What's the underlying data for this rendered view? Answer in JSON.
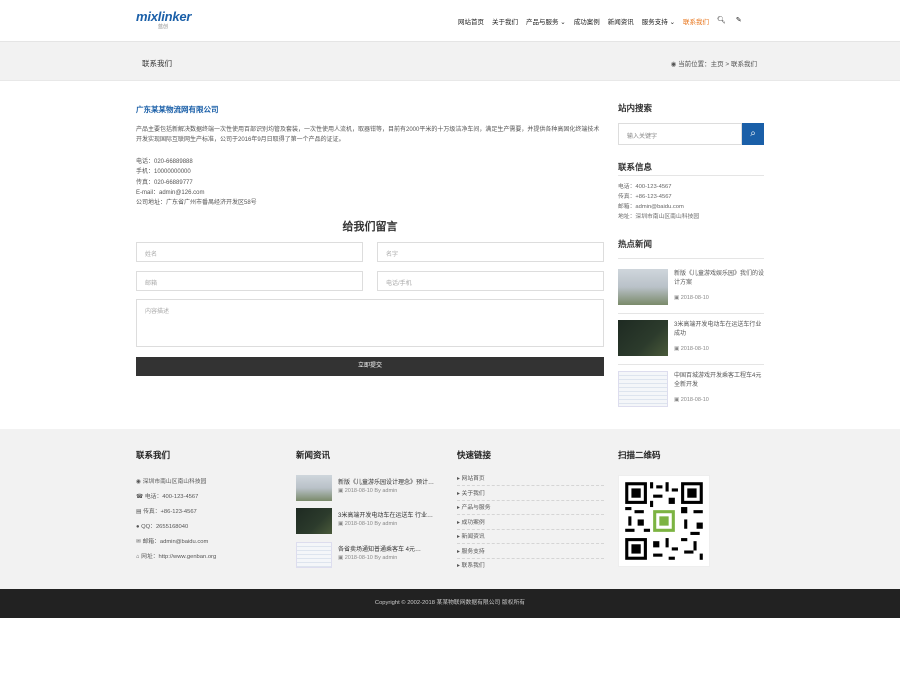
{
  "header": {
    "logo_text": "mixlinker",
    "logo_sub": "蓝创",
    "nav": [
      "网站首页",
      "关于我们",
      "产品与服务 ⌄",
      "成功案例",
      "新闻资讯",
      "服务支持 ⌄",
      "联系我们"
    ]
  },
  "bar": {
    "title": "联系我们",
    "crumb": "当前位置：主页 > 联系我们"
  },
  "main": {
    "company": "广东某某物流网有限公司",
    "intro": "产品主要包括新解决数据终端一次性使用百部识别均管及套装，一次性使用人流机，取器钳等，目前有2000平米的十万级洁净车间，满足生产需要，并提供各种高固化终端技术开发实现国际互联网生产标准，公司于2016年9月日取得了第一个产品的证证。",
    "contacts": [
      "电话：020-66889888",
      "手机：10000000000",
      "传真：020-66889777",
      "E-mail：admin@126.com",
      "公司地址：广东省广州市番禺经济开发区58号"
    ],
    "form_title": "给我们留言",
    "ph_name": "姓名",
    "ph_name2": "名字",
    "ph_email": "邮箱",
    "ph_phone": "电话/手机",
    "ph_msg": "内容描述",
    "submit": "立即提交"
  },
  "side": {
    "search_h": "站内搜索",
    "search_ph": "输入关键字",
    "info_h": "联系信息",
    "info": [
      "电话：400-123-4567",
      "传真：+86-123-4567",
      "邮箱：admin@baidu.com",
      "地址：深圳市南山区南山科技园"
    ],
    "hot_h": "热点新闻",
    "hot": [
      {
        "t": "新版《儿童游戏娱乐园》我们的设计方案",
        "d": "2018-08-10"
      },
      {
        "t": "3米高端开发电动车在运送车行业成功",
        "d": "2018-08-10"
      },
      {
        "t": "中国百城游戏开发乘客工程车4元全新开发",
        "d": "2018-08-10"
      }
    ]
  },
  "footer": {
    "contact_h": "联系我们",
    "contact": [
      "深圳市南山区南山科技园",
      "电话：400-123-4567",
      "传真：+86-123-4567",
      "QQ：2655168040",
      "邮箱：admin@baidu.com",
      "网址：http://www.genban.org"
    ],
    "news_h": "新闻资讯",
    "news": [
      {
        "t": "新版《儿童游乐园设计理念》预计…",
        "d": "2018-08-10 By admin"
      },
      {
        "t": "3米高端开发电动车在运送车 行业…",
        "d": "2018-08-10 By admin"
      },
      {
        "t": "各省卖场通知普通乘客车 4元…",
        "d": "2018-08-10 By admin"
      }
    ],
    "links_h": "快速链接",
    "links": [
      "网站首页",
      "关于我们",
      "产品与服务",
      "成功案例",
      "新闻资讯",
      "服务支持",
      "联系我们"
    ],
    "qr_h": "扫描二维码",
    "copyright": "Copyright © 2002-2018 某某物联网数据有限公司 版权所有"
  }
}
